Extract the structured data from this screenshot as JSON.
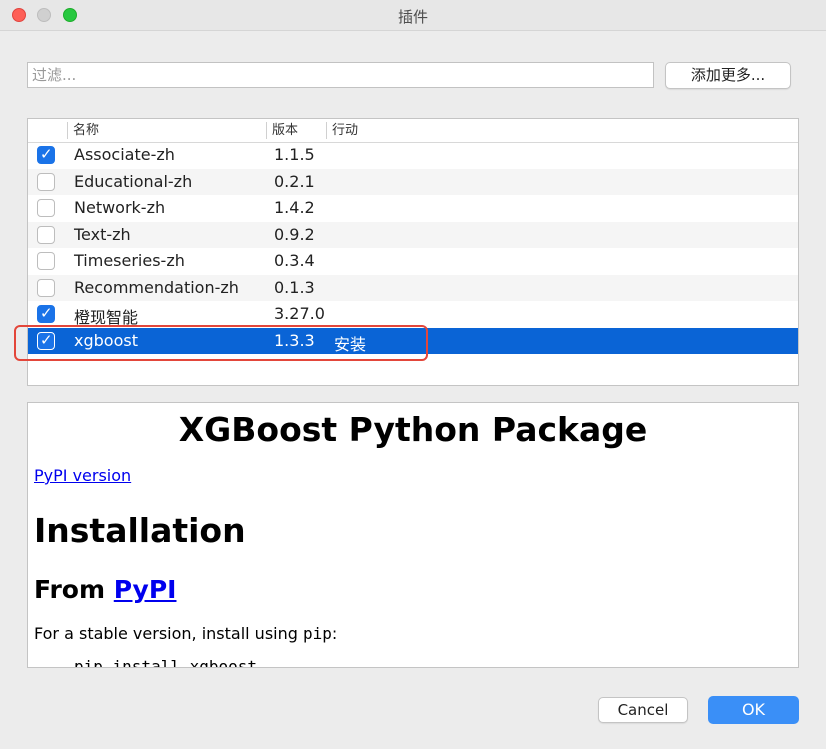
{
  "window": {
    "title": "插件"
  },
  "filter": {
    "placeholder": "过滤...",
    "value": ""
  },
  "add_more_label": "添加更多...",
  "table": {
    "headers": {
      "name": "名称",
      "version": "版本",
      "action": "行动"
    },
    "rows": [
      {
        "name": "Associate-zh",
        "version": "1.1.5",
        "action": "",
        "checked": true,
        "selected": false
      },
      {
        "name": "Educational-zh",
        "version": "0.2.1",
        "action": "",
        "checked": false,
        "selected": false
      },
      {
        "name": "Network-zh",
        "version": "1.4.2",
        "action": "",
        "checked": false,
        "selected": false
      },
      {
        "name": "Text-zh",
        "version": "0.9.2",
        "action": "",
        "checked": false,
        "selected": false
      },
      {
        "name": "Timeseries-zh",
        "version": "0.3.4",
        "action": "",
        "checked": false,
        "selected": false
      },
      {
        "name": "Recommendation-zh",
        "version": "0.1.3",
        "action": "",
        "checked": false,
        "selected": false
      },
      {
        "name": "橙现智能",
        "version": "3.27.0",
        "action": "",
        "checked": true,
        "selected": false
      },
      {
        "name": "xgboost",
        "version": "1.3.3",
        "action": "安装",
        "checked": true,
        "selected": true
      }
    ]
  },
  "preview": {
    "title": "XGBoost Python Package",
    "link": "PyPI version",
    "heading_installation": "Installation",
    "heading_from": "From",
    "heading_from_link": "PyPI",
    "paragraph_prefix": "For a stable version, install using",
    "paragraph_code": "pip",
    "paragraph_suffix": ":",
    "code_line": "pip install xgboost"
  },
  "buttons": {
    "cancel": "Cancel",
    "ok": "OK"
  },
  "colors": {
    "selection": "#0a64d6",
    "highlight_box": "#e3463a",
    "ok_button": "#3a8ff7",
    "checkbox_checked": "#1a73e8"
  }
}
